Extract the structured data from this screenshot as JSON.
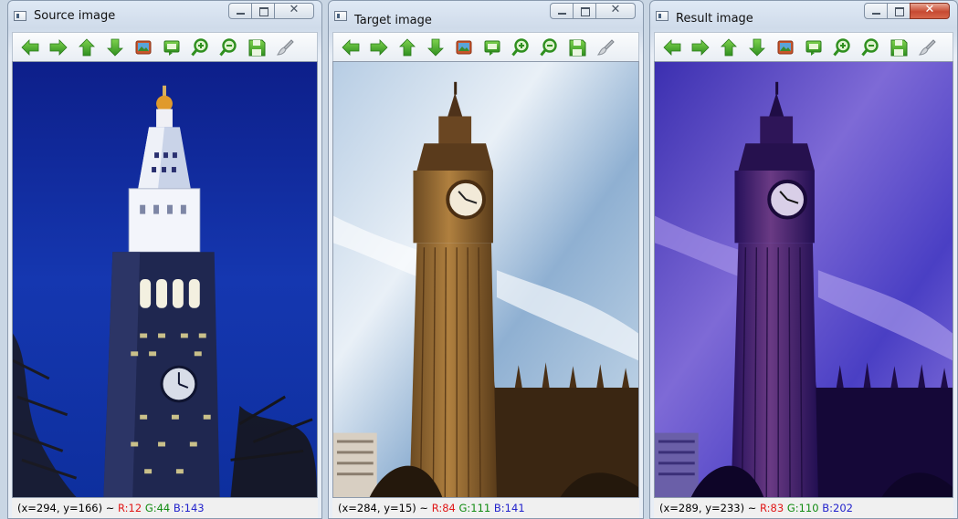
{
  "windows": [
    {
      "title": "Source image",
      "status": {
        "coords": "(x=294, y=166) ~ ",
        "r": "R:12",
        "g": "G:44",
        "b": "B:143"
      }
    },
    {
      "title": "Target image",
      "status": {
        "coords": "(x=284, y=15) ~ ",
        "r": "R:84",
        "g": "G:111",
        "b": "B:141"
      }
    },
    {
      "title": "Result image",
      "status": {
        "coords": "(x=289, y=233) ~ ",
        "r": "R:83",
        "g": "G:110",
        "b": "B:202"
      }
    }
  ],
  "caption_buttons": {
    "close_glyph": "✕"
  },
  "toolbar_icons": [
    "arrow-left-icon",
    "arrow-right-icon",
    "arrow-up-icon",
    "arrow-down-icon",
    "image-icon",
    "zoom-fit-icon",
    "zoom-in-icon",
    "zoom-out-icon",
    "save-icon",
    "brush-icon"
  ],
  "colors": {
    "icon_green": "#3aa02c",
    "title_bg": "#d6e2ef",
    "status_r": "#e01818",
    "status_g": "#118b11",
    "status_b": "#2222cc"
  }
}
